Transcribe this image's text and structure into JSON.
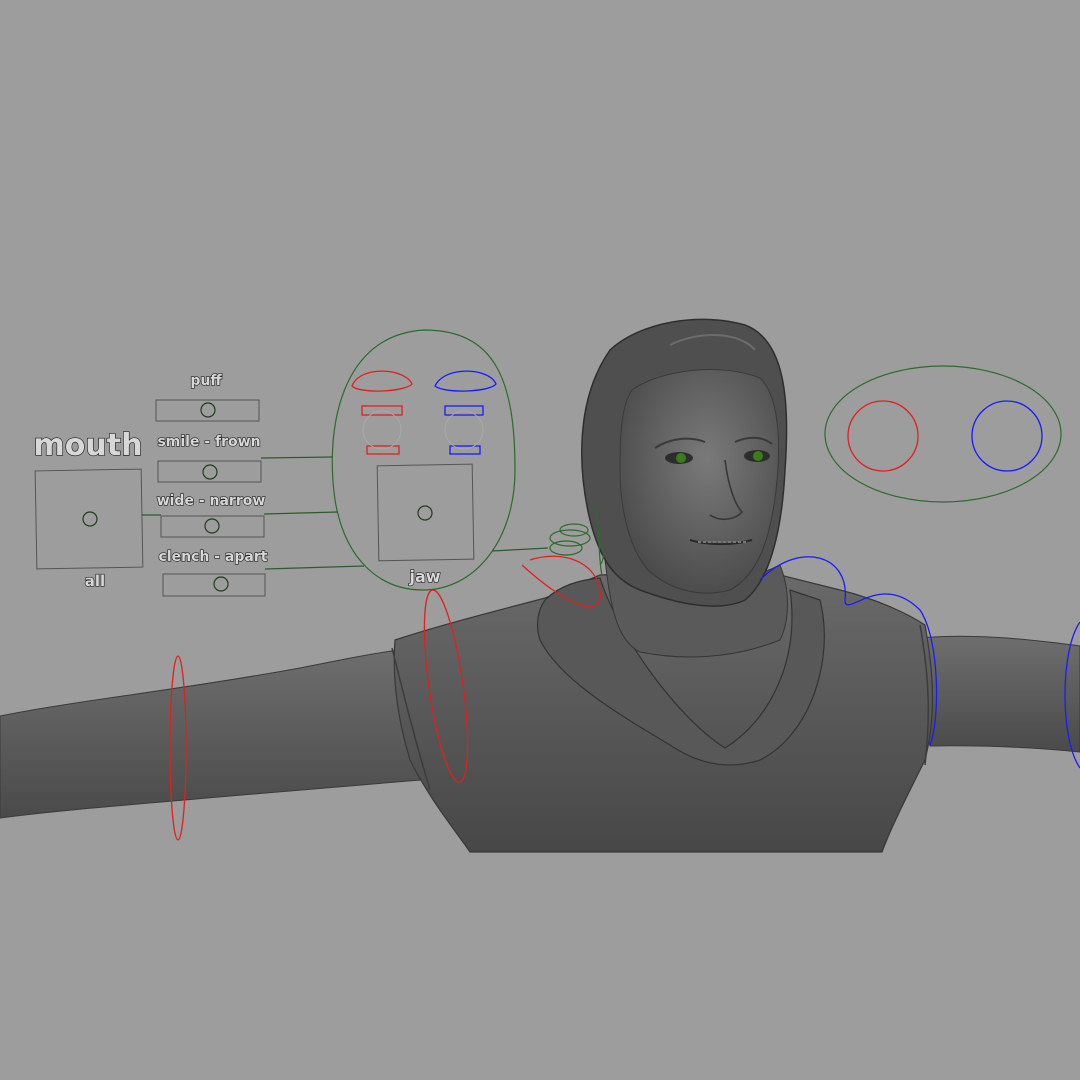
{
  "viewport": {
    "background": "#9d9d9d"
  },
  "mouth_panel": {
    "title": "mouth",
    "all_label": "all",
    "sliders": [
      {
        "label": "puff"
      },
      {
        "label": "smile - frown"
      },
      {
        "label": "wide - narrow"
      },
      {
        "label": "clench - apart"
      }
    ]
  },
  "face_panel": {
    "jaw_label": "jaw"
  },
  "colors": {
    "left_side": "#e02020",
    "right_side": "#1a1aff",
    "center": "#2d6a2d",
    "mesh": "#5e5e5e",
    "eyes": "#3d7a1a"
  }
}
